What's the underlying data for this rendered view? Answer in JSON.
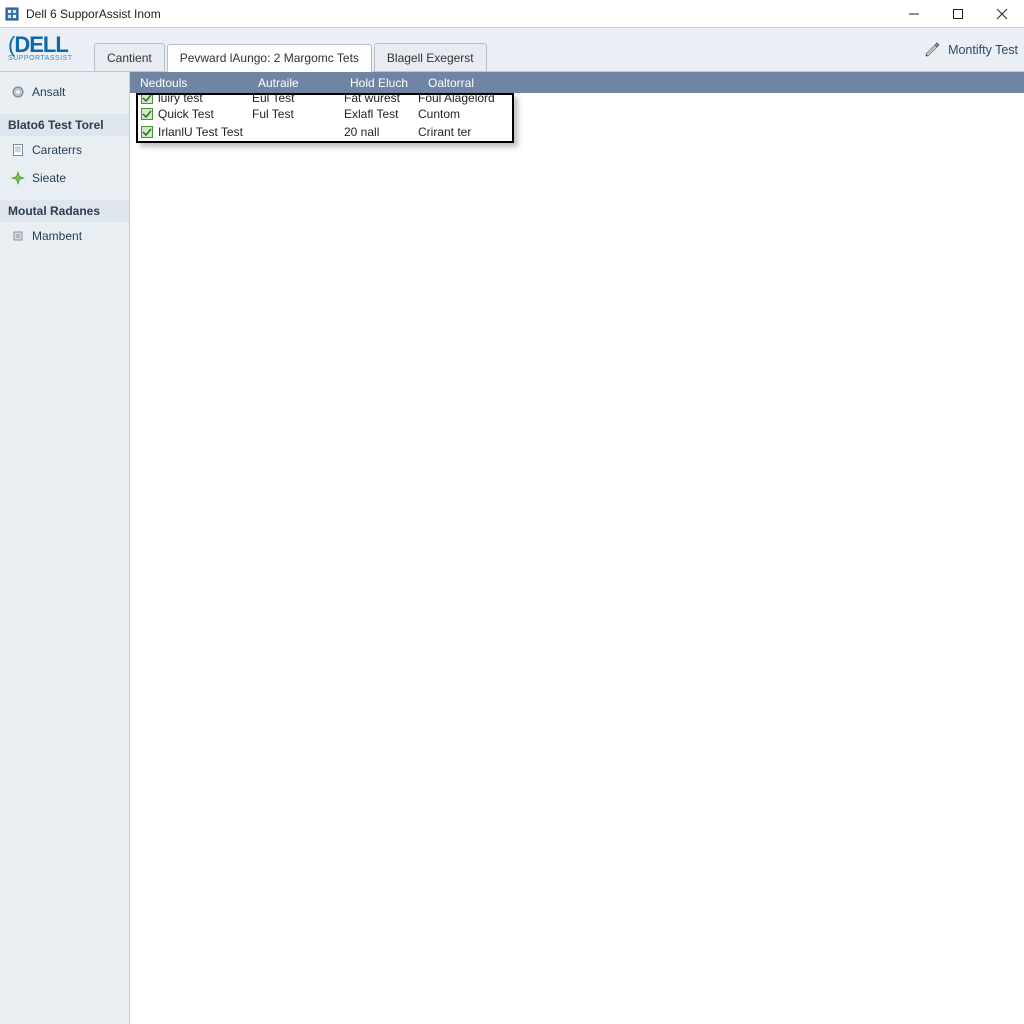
{
  "window": {
    "title": "Dell 6 SupporAssist Inom"
  },
  "branding": {
    "logo_text": "DELL",
    "logo_sub": "supportassist"
  },
  "tabs": [
    {
      "label": "Cantient",
      "active": false
    },
    {
      "label": "Pevward lAungo: 2 Margomc Tets",
      "active": true
    },
    {
      "label": "Blagell Exegerst",
      "active": false
    }
  ],
  "header_action": {
    "label": "Montifty Test"
  },
  "sidebar": {
    "items": [
      {
        "kind": "item",
        "label": "Ansalt",
        "icon": "gear-icon"
      },
      {
        "kind": "heading",
        "label": "Blato6 Test Torel"
      },
      {
        "kind": "item",
        "label": "Caraterrs",
        "icon": "document-icon"
      },
      {
        "kind": "item",
        "label": "Sieate",
        "icon": "sparkle-icon"
      },
      {
        "kind": "heading",
        "label": "Moutal Radanes"
      },
      {
        "kind": "item",
        "label": "Mambent",
        "icon": "chip-icon"
      }
    ]
  },
  "columns": [
    "Nedtouls",
    "Autraile",
    "Hold Eluch",
    "Oaltorral"
  ],
  "rows": [
    {
      "clipped": true,
      "c1": "luiry test",
      "c2": "Eul Test",
      "c3": "Fat wurest",
      "c4": "Foul Alagelord"
    },
    {
      "clipped": false,
      "c1": "Quick Test",
      "c2": "Ful Test",
      "c3": "Exlafl Test",
      "c4": "Cuntom"
    },
    {
      "clipped": false,
      "c1": "IrlanlU Test Test",
      "c2": "",
      "c3": "20 nall",
      "c4": "Crirant ter"
    }
  ]
}
